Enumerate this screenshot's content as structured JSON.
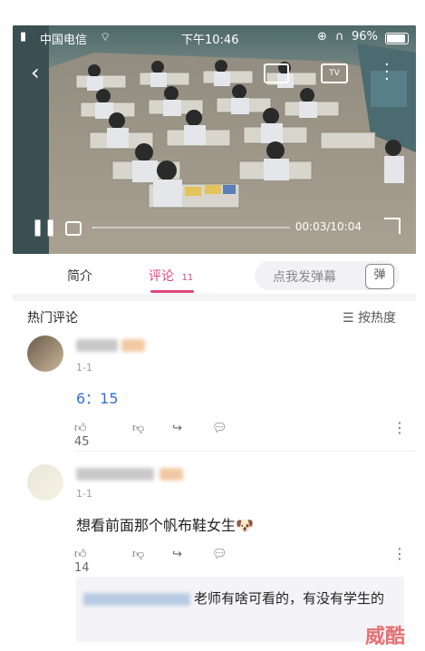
{
  "status_bar": {
    "carrier": "中国电信",
    "time": "下午10:46",
    "battery": "96%"
  },
  "video": {
    "current_time": "00:03",
    "total_time": "10:04",
    "time_display": "00:03/10:04",
    "progress": 0.005
  },
  "tabs": [
    {
      "label": "简介"
    },
    {
      "label": "评论",
      "count": "11"
    }
  ],
  "danmu": {
    "placeholder": "点我发弹幕",
    "button": "弹"
  },
  "section": {
    "title": "热门评论",
    "sort": "按热度"
  },
  "comments": [
    {
      "date": "1-1",
      "text": "6：15",
      "likes": "45"
    },
    {
      "date": "1-1",
      "text": "想看前面那个帆布鞋女生",
      "emoji": "🐶",
      "likes": "14"
    }
  ],
  "reply": {
    "text": "老师有啥可看的，有没有学生的"
  },
  "watermark": "威酷",
  "colors": {
    "accent": "#e0467a",
    "video_bg": "#3d4a50"
  }
}
